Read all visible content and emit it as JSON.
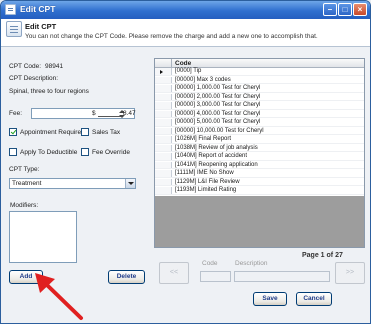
{
  "window": {
    "title": "Edit CPT"
  },
  "header": {
    "title": "Edit CPT",
    "subtitle": "You can not change the CPT Code.  Please remove the charge and add a new one to accomplish that."
  },
  "form": {
    "cpt_code_label": "CPT Code:",
    "cpt_code_value": "98941",
    "cpt_desc_label": "CPT Description:",
    "cpt_desc_value": "Spinal, three to four regions",
    "fee_label": "Fee:",
    "fee_prefix": "$",
    "fee_value": "8.47",
    "appointment_required_label": "Appointment Required",
    "appointment_required_checked": true,
    "sales_tax_label": "Sales Tax",
    "sales_tax_checked": false,
    "apply_to_deductible_label": "Apply To Deductible",
    "apply_to_deductible_checked": false,
    "fee_override_label": "Fee Override",
    "fee_override_checked": false,
    "cpt_type_label": "CPT Type:",
    "cpt_type_value": "Treatment",
    "modifiers_label": "Modifiers:"
  },
  "buttons": {
    "add": "Add",
    "delete": "Delete",
    "prev": "<<",
    "next": ">>",
    "save": "Save",
    "cancel": "Cancel"
  },
  "grid": {
    "column": "Code",
    "rows": [
      "[0000] Tip",
      "[00000] Max 3 codes",
      "[00000] 1,000.00 Test for Cheryl",
      "[00000] 2,000.00 Test for Cheryl",
      "[00000] 3,000.00 Test for Cheryl",
      "[00000] 4,000.00 Test for Cheryl",
      "[00000] 5,000.00 Test for Cheryl",
      "[00000] 10,000.00 Test for Cheryl",
      "[1026M] Final Report",
      "[1038M] Review of job analysis",
      "[1040M] Report of accident",
      "[1041M] Reopening application",
      "[1111M] IME No Show",
      "[1129M] L&I File Review",
      "[1193M] Limited Rating"
    ]
  },
  "pager": {
    "label": "Page 1 of 27",
    "code_label": "Code",
    "description_label": "Description"
  },
  "colors": {
    "accent": "#2f6fcf",
    "annotation_arrow": "#e02020"
  }
}
